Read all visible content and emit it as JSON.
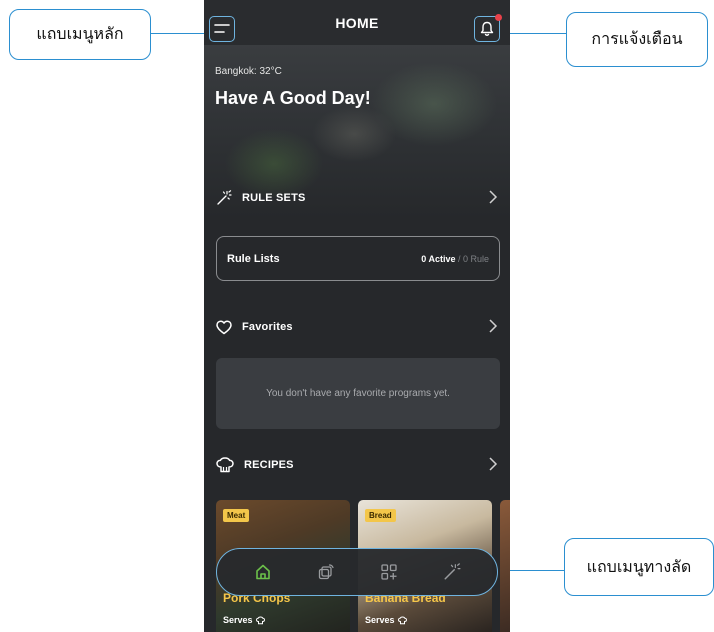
{
  "callouts": {
    "main_menu": "แถบเมนูหลัก",
    "notifications": "การแจ้งเตือน",
    "shortcut_bar": "แถบเมนูทางลัด"
  },
  "header": {
    "title": "HOME"
  },
  "hero": {
    "weather": "Bangkok: 32°C",
    "greeting": "Have A Good Day!"
  },
  "rule_sets": {
    "label": "RULE SETS",
    "card": {
      "name": "Rule Lists",
      "active": "0 Active",
      "total": " / 0 Rule"
    }
  },
  "favorites": {
    "label": "Favorites",
    "empty_message": "You don't have any favorite programs yet."
  },
  "recipes": {
    "label": "RECIPES",
    "items": [
      {
        "tag": "Meat",
        "name": "Pork Chops",
        "serves": "Serves"
      },
      {
        "tag": "Bread",
        "name": "Banana Bread",
        "serves": "Serves"
      }
    ]
  },
  "bottom_nav": {
    "items": [
      "home-icon",
      "device-remote-icon",
      "add-widget-icon",
      "magic-wand-icon"
    ],
    "active_color": "#6cc04a"
  },
  "colors": {
    "accent": "#2b8fd0",
    "highlight": "#f3c64a",
    "notification_dot": "#e8414a"
  }
}
